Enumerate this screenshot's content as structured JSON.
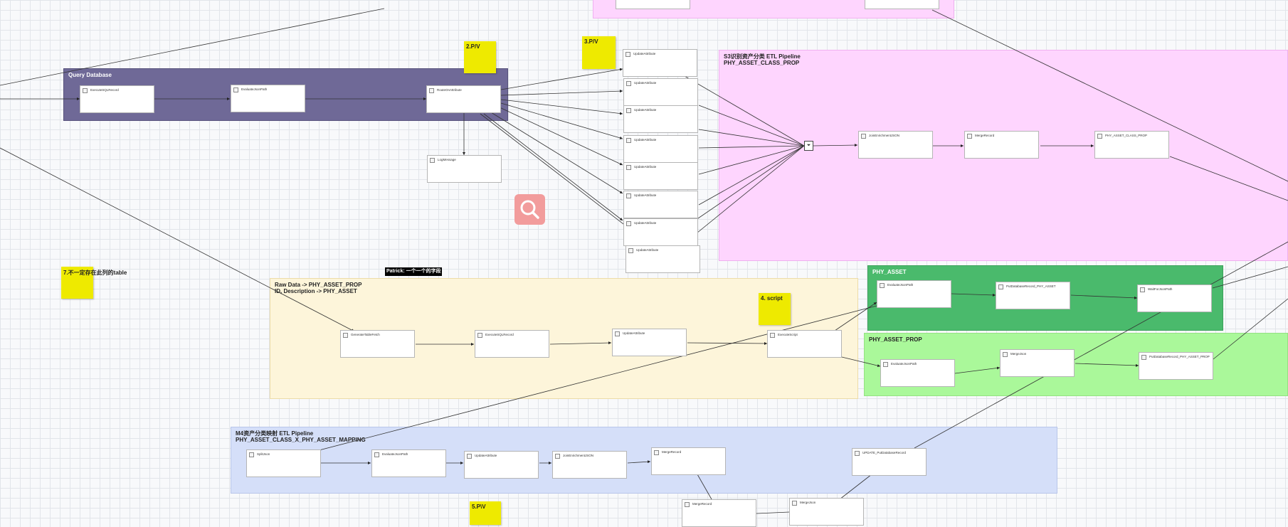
{
  "groups": {
    "query": {
      "title": "Query Database"
    },
    "s3": {
      "title": "S3识别资产分类 ETL Pipeline\nPHY_ASSET_CLASS_PROP"
    },
    "raw": {
      "title": "Raw Data -> PHY_ASSET_PROP\nID, Description -> PHY_ASSET"
    },
    "phy": {
      "title": "PHY_ASSET"
    },
    "phyprop": {
      "title": "PHY_ASSET_PROP"
    },
    "m4": {
      "title": "M4资产分类映射 ETL Pipeline\nPHY_ASSET_CLASS_X_PHY_ASSET_MAPPING"
    }
  },
  "stickies": {
    "s2": "2.P/V",
    "s3": "3.P/V",
    "s4": "4. script",
    "s5": "5.P\\V",
    "s7": "7.不一定存在此列的table"
  },
  "label_black": "Patrick: 一个一个的字段",
  "nodes": {
    "query": [
      "ExecuteSQLRecord",
      "EvaluateJsonPath",
      "RouteOnAttribute"
    ],
    "log": "LogMessage",
    "update_col": [
      "UpdateAttribute",
      "UpdateAttribute",
      "UpdateAttribute",
      "UpdateAttribute",
      "UpdateAttribute",
      "UpdateAttribute",
      "UpdateAttribute",
      "UpdateAttribute"
    ],
    "s3": [
      "JoinEnrichmentJSON",
      "MergeRecord",
      "PHY_ASSET_CLASS_PROP"
    ],
    "raw": [
      "GenerateTableFetch",
      "ExecuteSQLRecord",
      "UpdateAttribute",
      "ExecuteScript"
    ],
    "phy": [
      "EvaluateJsonPath",
      "PutDatabaseRecord_PHY_ASSET",
      "WaitForJsonPath"
    ],
    "phyprop": [
      "EvaluateJsonPath",
      "MergeJson",
      "PutDatabaseRecord_PHY_ASSET_PROP"
    ],
    "m4": [
      "SplitJson",
      "EvaluateJsonPath",
      "UpdateAttribute",
      "JoinEnrichmentJSON",
      "MergeRecord",
      "UPDATE_PutDatabaseRecord"
    ],
    "m4b": [
      "MergeRecord",
      "MergeJson"
    ]
  },
  "funnel_icon": "funnel-icon",
  "search_icon": "search-icon",
  "colors": {
    "query": "#6f6997",
    "s3": "#fed5fe",
    "raw": "#fdf5da",
    "phy": "#4aba6c",
    "phyprop": "#aaf89a",
    "m4": "#d5dff9",
    "sticky": "#eeea00",
    "search": "#f29c9c"
  }
}
